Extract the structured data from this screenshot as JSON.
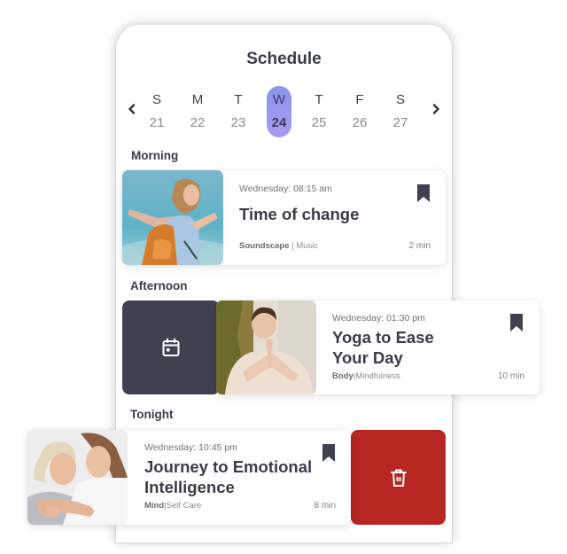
{
  "header": {
    "title": "Schedule"
  },
  "week": {
    "prev_icon": "chevron-left-icon",
    "next_icon": "chevron-right-icon",
    "days": [
      {
        "letter": "S",
        "date": "21",
        "selected": false
      },
      {
        "letter": "M",
        "date": "22",
        "selected": false
      },
      {
        "letter": "T",
        "date": "23",
        "selected": false
      },
      {
        "letter": "W",
        "date": "24",
        "selected": true
      },
      {
        "letter": "T",
        "date": "25",
        "selected": false
      },
      {
        "letter": "F",
        "date": "26",
        "selected": false
      },
      {
        "letter": "S",
        "date": "27",
        "selected": false
      }
    ],
    "selected_gradient": [
      "#8a95e8",
      "#a99af2"
    ]
  },
  "sections": [
    {
      "label": "Morning",
      "item": {
        "time": "Wednesday: 08:15 am",
        "title": "Time of change",
        "category": "Soundscape",
        "subcategory": "Music",
        "duration": "2 min",
        "image": "woman-with-backpack-arms-outstretched-photo",
        "bookmark_icon": "bookmark-icon"
      }
    },
    {
      "label": "Afternoon",
      "item": {
        "time": "Wednesday: 01:30 pm",
        "title_line1": "Yoga to Ease",
        "title_line2": "Your Day",
        "category": "Body",
        "subcategory": "Mindfulness",
        "duration": "10 min",
        "image": "woman-yoga-prayer-pose-photo",
        "bookmark_icon": "bookmark-icon",
        "swipe_action": {
          "icon": "calendar-icon",
          "color": "#3f4050"
        }
      }
    },
    {
      "label": "Tonight",
      "item": {
        "time": "Wednesday: 10:45 pm",
        "title_line1": "Journey to Emotional",
        "title_line2": "Intelligence",
        "category": "Mind",
        "subcategory": "Self Care",
        "duration": "8 min",
        "image": "mother-daughter-hugging-photo",
        "bookmark_icon": "bookmark-icon",
        "swipe_action": {
          "icon": "trash-icon",
          "color": "#b72621"
        }
      }
    }
  ],
  "separator": "|"
}
